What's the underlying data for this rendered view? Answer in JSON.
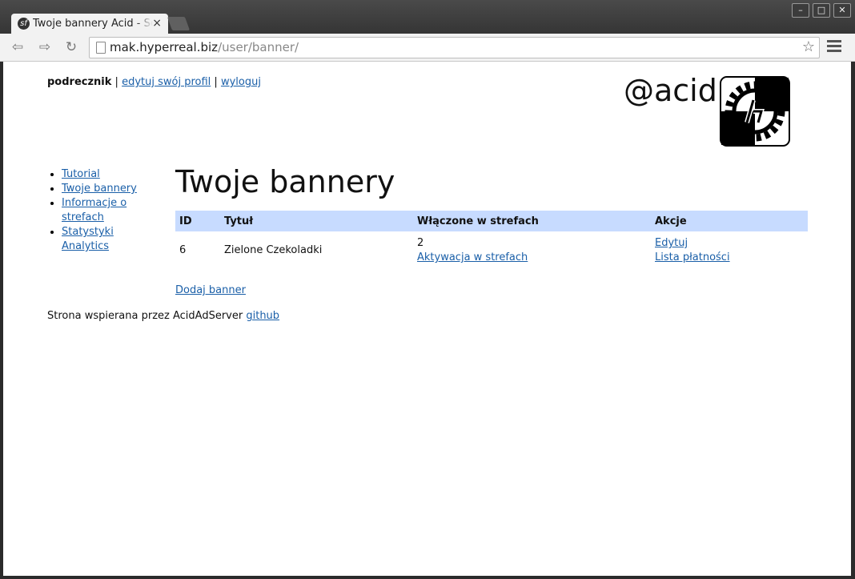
{
  "browser": {
    "tab_title": "Twoje bannery Acid - Se",
    "tab_close": "×",
    "url_host": "mak.hyperreal.biz",
    "url_path": "/user/banner/",
    "window_buttons": [
      "–",
      "□",
      "✕"
    ],
    "icons": [
      "back-icon",
      "forward-icon",
      "reload-icon",
      "page-icon",
      "star-icon",
      "menu-icon"
    ]
  },
  "topnav": {
    "user": "podrecznik",
    "sep": "|",
    "edit_profile": "edytuj swój profil",
    "logout": "wyloguj"
  },
  "brand": {
    "name": "@acid"
  },
  "sidebar": {
    "items": [
      {
        "label": "Tutorial"
      },
      {
        "label": "Twoje bannery"
      },
      {
        "label": "Informacje o strefach"
      },
      {
        "label": "Statystyki Analytics"
      }
    ]
  },
  "main": {
    "title": "Twoje bannery",
    "table": {
      "headers": [
        "ID",
        "Tytuł",
        "Włączone w strefach",
        "Akcje"
      ],
      "rows": [
        {
          "id": "6",
          "title": "Zielone Czekoladki",
          "zones_count": "2",
          "zones_link": "Aktywacja w strefach",
          "action_edit": "Edytuj",
          "action_payments": "Lista płatności"
        }
      ]
    },
    "add_banner": "Dodaj banner"
  },
  "footer": {
    "text": "Strona wspierana przez AcidAdServer",
    "link": "github"
  },
  "colors": {
    "table_header": "#c7dbff",
    "link": "#1a5fa8"
  }
}
